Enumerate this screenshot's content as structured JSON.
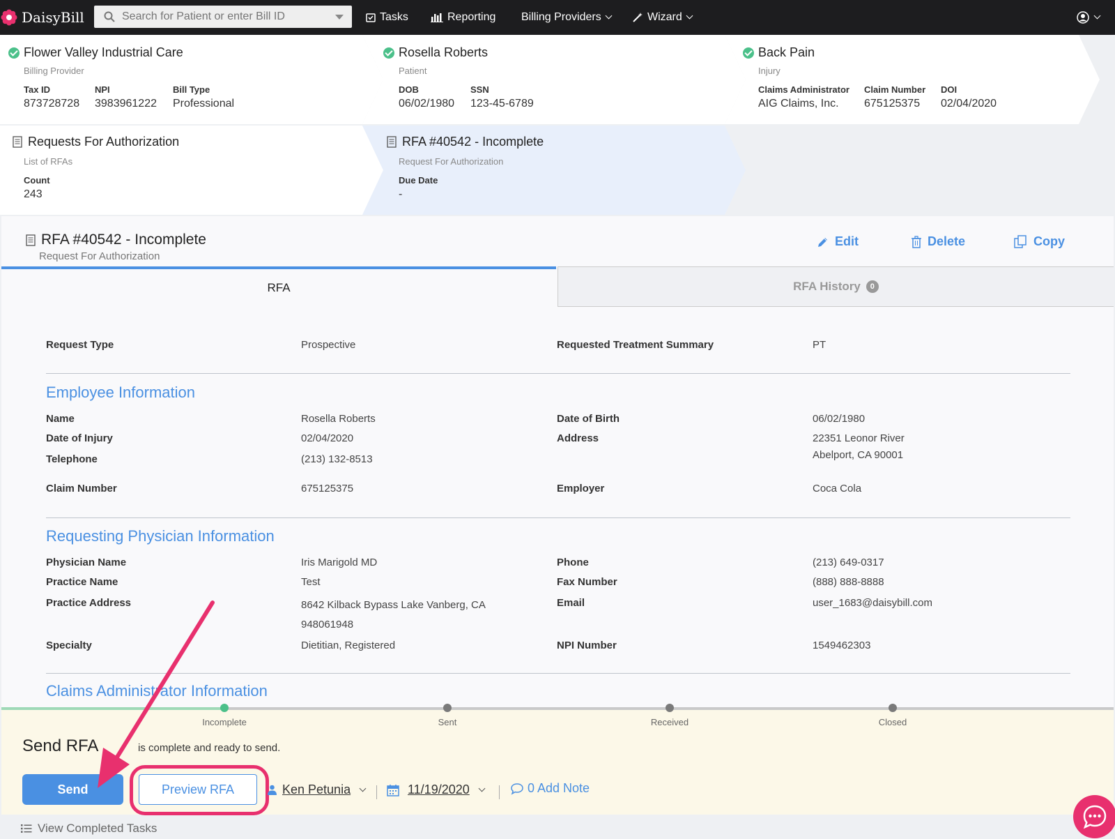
{
  "nav": {
    "logo_text": "DaisyBill",
    "search_placeholder": "Search for Patient or enter Bill ID",
    "tasks_label": "Tasks",
    "reporting_label": "Reporting",
    "billing_providers_label": "Billing Providers",
    "wizard_label": "Wizard"
  },
  "breadcrumbs": {
    "provider": {
      "title": "Flower Valley Industrial Care",
      "subtitle": "Billing Provider",
      "fields": [
        {
          "label": "Tax ID",
          "value": "873728728"
        },
        {
          "label": "NPI",
          "value": "3983961222"
        },
        {
          "label": "Bill Type",
          "value": "Professional"
        }
      ]
    },
    "patient": {
      "title": "Rosella Roberts",
      "subtitle": "Patient",
      "fields": [
        {
          "label": "DOB",
          "value": "06/02/1980"
        },
        {
          "label": "SSN",
          "value": "123-45-6789"
        }
      ]
    },
    "injury": {
      "title": "Back Pain",
      "subtitle": "Injury",
      "fields": [
        {
          "label": "Claims Administrator",
          "value": "AIG Claims, Inc."
        },
        {
          "label": "Claim Number",
          "value": "675125375"
        },
        {
          "label": "DOI",
          "value": "02/04/2020"
        }
      ]
    },
    "rfas": {
      "title": "Requests For Authorization",
      "subtitle": "List of RFAs",
      "fields": [
        {
          "label": "Count",
          "value": "243"
        }
      ]
    },
    "rfa": {
      "title": "RFA #40542 - Incomplete",
      "subtitle": "Request For Authorization",
      "fields": [
        {
          "label": "Due Date",
          "value": "-"
        }
      ]
    }
  },
  "main": {
    "title": "RFA #40542 - Incomplete",
    "subtitle": "Request For Authorization",
    "actions": {
      "edit": "Edit",
      "delete": "Delete",
      "copy": "Copy"
    },
    "tabs": [
      {
        "label": "RFA",
        "active": true
      },
      {
        "label": "RFA History",
        "badge": "0",
        "active": false
      }
    ],
    "request": {
      "type_label": "Request Type",
      "type_value": "Prospective",
      "summary_label": "Requested Treatment Summary",
      "summary_value": "PT"
    },
    "employee": {
      "heading": "Employee Information",
      "name_label": "Name",
      "name_value": "Rosella Roberts",
      "doi_label": "Date of Injury",
      "doi_value": "02/04/2020",
      "tel_label": "Telephone",
      "tel_value": "(213) 132-8513",
      "claim_label": "Claim Number",
      "claim_value": "675125375",
      "dob_label": "Date of Birth",
      "dob_value": "06/02/1980",
      "address_label": "Address",
      "address_line1": "22351 Leonor River",
      "address_line2": "Abelport, CA 90001",
      "employer_label": "Employer",
      "employer_value": "Coca Cola"
    },
    "physician": {
      "heading": "Requesting Physician Information",
      "name_label": "Physician Name",
      "name_value": "Iris Marigold MD",
      "practice_label": "Practice Name",
      "practice_value": "Test",
      "address_label": "Practice Address",
      "address_line1": "8642 Kilback Bypass Lake Vanberg, CA",
      "address_line2": "948061948",
      "specialty_label": "Specialty",
      "specialty_value": "Dietitian, Registered",
      "phone_label": "Phone",
      "phone_value": "(213) 649-0317",
      "fax_label": "Fax Number",
      "fax_value": "(888) 888-8888",
      "email_label": "Email",
      "email_value": "user_1683@daisybill.com",
      "npi_label": "NPI Number",
      "npi_value": "1549462303"
    },
    "claims_admin": {
      "heading": "Claims Administrator Information"
    }
  },
  "task": {
    "steps": [
      "Incomplete",
      "Sent",
      "Received",
      "Closed"
    ],
    "current_step": 0,
    "title": "Send RFA",
    "description": "is complete and ready to send.",
    "send_label": "Send",
    "preview_label": "Preview RFA",
    "assignee": "Ken Petunia",
    "date": "11/19/2020",
    "note_label": "0 Add Note",
    "completed_label": "View Completed Tasks"
  },
  "colors": {
    "accent": "#4a90e2",
    "success": "#4bc08a",
    "highlight": "#e8306e",
    "task_bg": "#fcf8e8"
  }
}
